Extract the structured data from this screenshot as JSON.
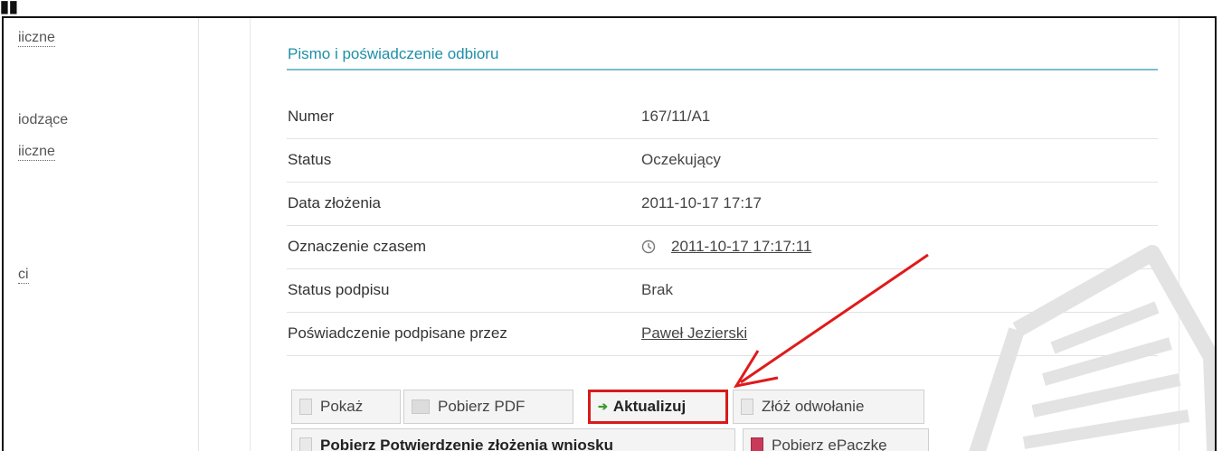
{
  "left_nav": {
    "items": [
      {
        "label": "iiczne"
      },
      {
        "label": "iodzące"
      },
      {
        "label": "iiczne"
      },
      {
        "label": "ci"
      }
    ]
  },
  "section": {
    "title": "Pismo i poświadczenie odbioru"
  },
  "details": [
    {
      "label": "Numer",
      "value": "167/11/A1"
    },
    {
      "label": "Status",
      "value": "Oczekujący"
    },
    {
      "label": "Data złożenia",
      "value": "2011-10-17 17:17"
    },
    {
      "label": "Oznaczenie czasem",
      "value": "2011-10-17 17:17:11"
    },
    {
      "label": "Status podpisu",
      "value": "Brak"
    },
    {
      "label": "Poświadczenie podpisane przez",
      "value": "Paweł Jezierski"
    }
  ],
  "buttons": {
    "show": "Pokaż",
    "download_pdf": "Pobierz PDF",
    "update": "Aktualizuj",
    "appeal": "Złóż odwołanie",
    "download_confirmation": "Pobierz Potwierdzenie złożenia wniosku",
    "download_package": "Pobierz ePaczkę"
  },
  "colors": {
    "accent": "#1f8fa8",
    "highlight_border": "#d81a1a",
    "arrow": "#e01a1a"
  }
}
